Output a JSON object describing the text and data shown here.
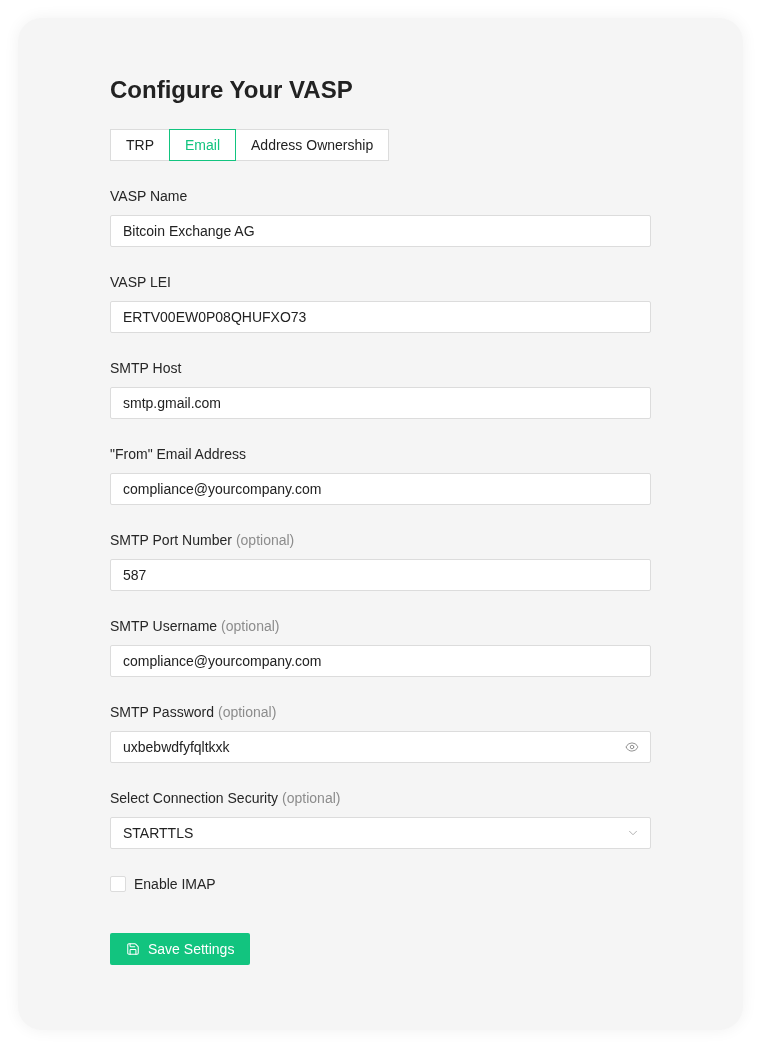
{
  "title": "Configure Your VASP",
  "tabs": [
    {
      "label": "TRP",
      "selected": false
    },
    {
      "label": "Email",
      "selected": true
    },
    {
      "label": "Address Ownership",
      "selected": false
    }
  ],
  "fields": [
    {
      "kind": "text",
      "label": "VASP Name",
      "value": "Bitcoin Exchange AG"
    },
    {
      "kind": "text",
      "label": "VASP LEI",
      "value": "ERTV00EW0P08QHUFXO73"
    },
    {
      "kind": "text",
      "label": "SMTP Host",
      "value": "smtp.gmail.com"
    },
    {
      "kind": "text",
      "label": "\"From\" Email Address",
      "value": "compliance@yourcompany.com"
    },
    {
      "kind": "text",
      "label": "SMTP Port Number",
      "note": "(optional)",
      "value": "587"
    },
    {
      "kind": "text",
      "label": "SMTP Username",
      "note": "(optional)",
      "value": "compliance@yourcompany.com"
    },
    {
      "kind": "password",
      "label": "SMTP Password",
      "note": "(optional)",
      "value": "uxbebwdfyfqltkxk"
    },
    {
      "kind": "select",
      "label": "Select Connection Security",
      "note": "(optional)",
      "value": "STARTTLS"
    }
  ],
  "checkbox": {
    "label": "Enable IMAP",
    "checked": false
  },
  "save_button": {
    "label": "Save Settings"
  }
}
